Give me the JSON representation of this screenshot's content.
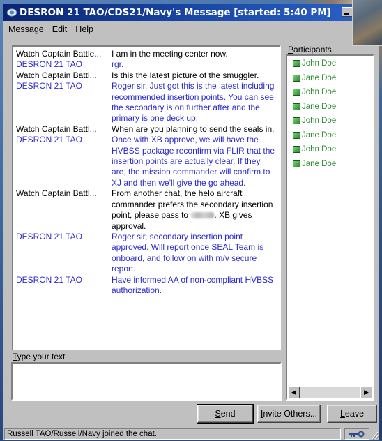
{
  "window": {
    "title": "DESRON 21 TAO/CDS21/Navy's Message  [started: 5:40 PM]"
  },
  "menu": [
    {
      "label": "Message",
      "accel": "M",
      "rest": "essage"
    },
    {
      "label": "Edit",
      "accel": "E",
      "rest": "dit"
    },
    {
      "label": "Help",
      "accel": "H",
      "rest": "elp"
    }
  ],
  "chat": {
    "messages": [
      {
        "sender": "Watch Captain Battle...",
        "text": "I am in the meeting center now.",
        "type": "remote"
      },
      {
        "sender": "DESRON 21 TAO",
        "text": "rgr.",
        "type": "local"
      },
      {
        "sender": "Watch Captain Battl...",
        "text": "Is this the latest picture of the smuggler.",
        "type": "remote"
      },
      {
        "sender": "DESRON 21 TAO",
        "text": "Roger sir.  Just got this is the latest including recommended insertion points.  You can see the secondary is on further after and the primary is one deck up.",
        "type": "local"
      },
      {
        "sender": "Watch Captain Battl...",
        "text": "When are you planning to send the seals in.",
        "type": "remote"
      },
      {
        "sender": "DESRON 21 TAO",
        "text": "Once with XB approve, we will have the HVBSS package reconfirm via FLIR that the insertion points are actually clear.  If they are, the mission commander will confirm to XJ and then we'll give the go ahead.",
        "type": "local"
      },
      {
        "sender": "Watch Captain Battl...",
        "text_before": "From another chat, the helo aircraft commander prefers the secondary insertion point, please pass to",
        "text_after": ".  XB gives approval.",
        "type": "remote",
        "redacted": true
      },
      {
        "sender": "DESRON 21 TAO",
        "text": "Roger sir, secondary insertion point approved.  Will report once SEAL Team is onboard, and follow on with m/v secure report.",
        "type": "local"
      },
      {
        "sender": "DESRON 21 TAO",
        "text": "Have informed AA of non-compliant HVBSS authorization.",
        "type": "local"
      }
    ]
  },
  "participants": {
    "label": "Participants",
    "accel": "P",
    "rest": "articipants",
    "names": [
      "John Doe",
      "Jane Doe",
      "John Doe",
      "Jane Doe",
      "John Doe",
      "Jane Doe",
      "John Doe",
      "Jane Doe"
    ]
  },
  "input": {
    "label": "Type your text",
    "accel": "T",
    "rest": "ype your text",
    "value": ""
  },
  "buttons": {
    "send": {
      "label": "Send",
      "accel": "S",
      "rest": "end"
    },
    "invite": {
      "label": "Invite Others...",
      "accel": "I",
      "rest": "nvite Others..."
    },
    "leave": {
      "label": "Leave",
      "accel": "L",
      "rest": "eave"
    }
  },
  "status": {
    "text": "Russell TAO/Russell/Navy joined the chat."
  },
  "colors": {
    "local_sender": "#2a2ad0",
    "remote_sender": "#000000",
    "participant": "#2a8a2a",
    "titlebar": "#0a2472"
  }
}
